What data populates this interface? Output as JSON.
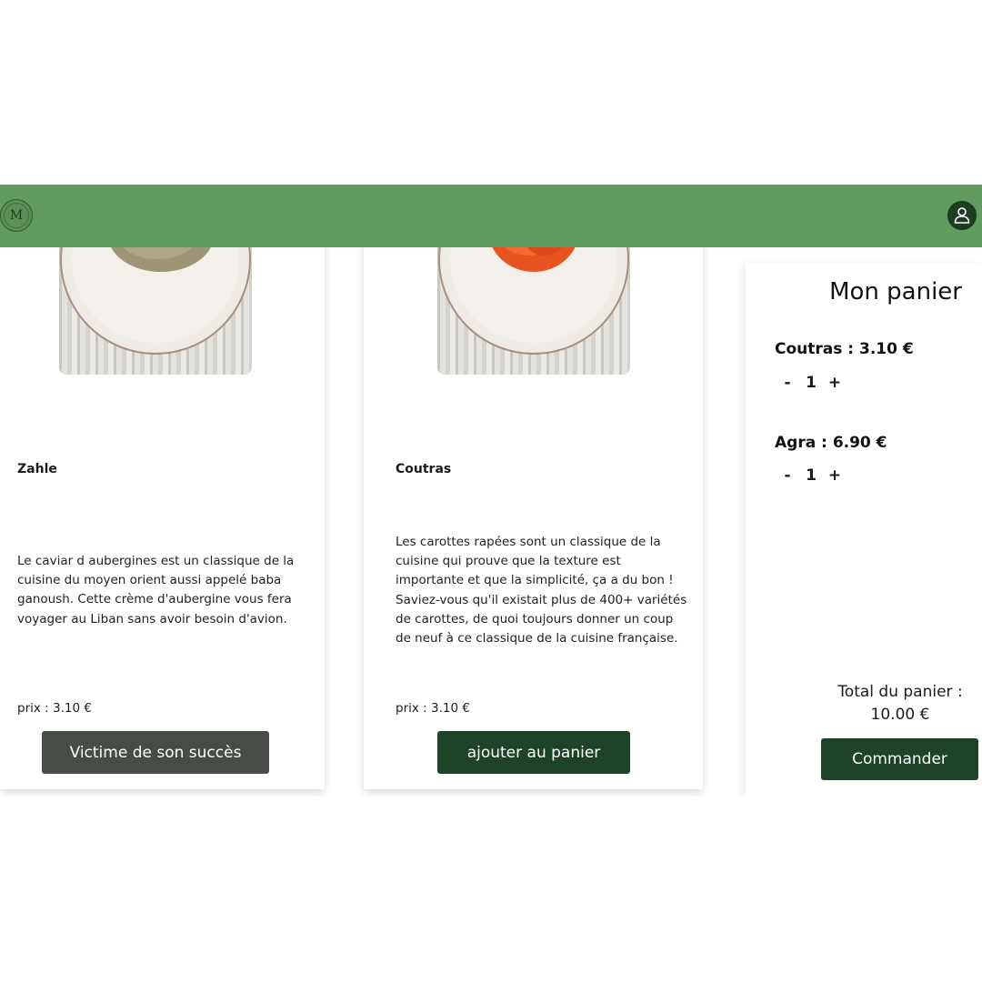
{
  "header": {
    "logo_text": "M",
    "logo_icon": "restaurant-logo-icon",
    "user_icon": "user-icon",
    "background": "#619b5d"
  },
  "products": [
    {
      "name": "Zahle",
      "description": "Le caviar d aubergines est un classique de la cuisine du moyen orient aussi appelé baba ganoush. Cette crème d'aubergine vous fera voyager au Liban sans avoir besoin d'avion.",
      "price": "prix : 3.10 €",
      "button_label": "Victime de son succès",
      "button_color": "#474c47",
      "image_icon": "eggplant-caviar-bowl-image"
    },
    {
      "name": "Coutras",
      "description": "Les carottes rapées sont un classique de la cuisine qui prouve que la texture est importante et que la simplicité, ça a du bon ! Saviez-vous qu'il existait plus de 400+ variétés de carottes, de quoi toujours donner un coup de neuf à ce classique de la cuisine française.",
      "price": "prix : 3.10 €",
      "button_label": "ajouter au panier",
      "button_color": "#1d4329",
      "image_icon": "grated-carrots-bowl-image"
    }
  ],
  "cart": {
    "title": "Mon panier",
    "items": [
      {
        "label": "Coutras : 3.10 €",
        "minus": "-",
        "qty": "1",
        "plus": "+"
      },
      {
        "label": "Agra : 6.90 €",
        "minus": "-",
        "qty": "1",
        "plus": "+"
      }
    ],
    "total_label": "Total du panier :",
    "total_value": "10.00 €",
    "order_label": "Commander",
    "accent": "#1d4329"
  }
}
